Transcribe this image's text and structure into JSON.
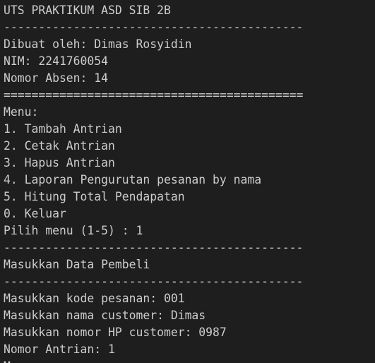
{
  "terminal": {
    "lines": [
      "UTS PRAKTIKUM ASD SIB 2B",
      "-------------------------------------------",
      "Dibuat oleh: Dimas Rosyidin",
      "NIM: 2241760054",
      "Nomor Absen: 14",
      "===========================================",
      "Menu:",
      "1. Tambah Antrian",
      "2. Cetak Antrian",
      "3. Hapus Antrian",
      "4. Laporan Pengurutan pesanan by nama",
      "5. Hitung Total Pendapatan",
      "0. Keluar",
      "Pilih menu (1-5) : 1",
      "-------------------------------------------",
      "Masukkan Data Pembeli",
      "-------------------------------------------",
      "Masukkan kode pesanan: 001",
      "Masukkan nama customer: Dimas",
      "Masukkan nomor HP customer: 0987",
      "Nomor Antrian: 1",
      "M"
    ]
  }
}
